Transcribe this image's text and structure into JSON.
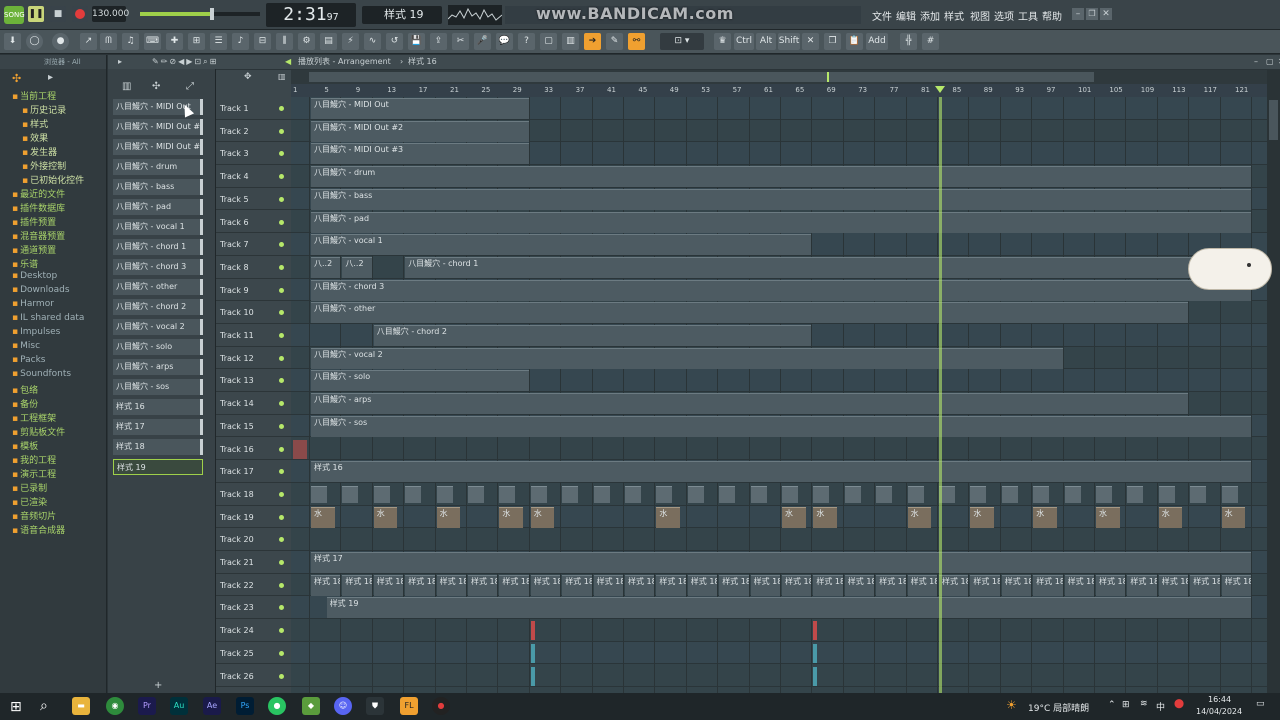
{
  "transport": {
    "tempo": "130.000",
    "time": "2:31",
    "time_frac": "97",
    "pattern": "样式 19"
  },
  "watermark": "www.BANDICAM.com",
  "menu": [
    "文件",
    "编辑",
    "添加",
    "样式",
    "视图",
    "选项",
    "工具",
    "帮助"
  ],
  "toolbar": {
    "ctrl": "Ctrl",
    "alt": "Alt",
    "shift": "Shift",
    "add": "Add"
  },
  "browser": {
    "title": "浏览器 - All",
    "items": [
      {
        "label": "当前工程",
        "kind": "root"
      },
      {
        "label": "历史记录",
        "kind": "sub"
      },
      {
        "label": "样式",
        "kind": "sub"
      },
      {
        "label": "效果",
        "kind": "sub"
      },
      {
        "label": "发生器",
        "kind": "sub"
      },
      {
        "label": "外接控制",
        "kind": "sub"
      },
      {
        "label": "已初始化控件",
        "kind": "sub"
      },
      {
        "label": "最近的文件",
        "kind": "root"
      },
      {
        "label": "插件数据库",
        "kind": "root"
      },
      {
        "label": "插件预置",
        "kind": "root"
      },
      {
        "label": "混音器预置",
        "kind": "root"
      },
      {
        "label": "通道预置",
        "kind": "root"
      },
      {
        "label": "乐谱",
        "kind": "root"
      },
      {
        "label": "Desktop",
        "kind": "folder"
      },
      {
        "label": "Downloads",
        "kind": "folder"
      },
      {
        "label": "Harmor",
        "kind": "folder"
      },
      {
        "label": "IL shared data",
        "kind": "folder"
      },
      {
        "label": "Impulses",
        "kind": "folder"
      },
      {
        "label": "Misc",
        "kind": "folder"
      },
      {
        "label": "Packs",
        "kind": "folder"
      },
      {
        "label": "Soundfonts",
        "kind": "folder"
      },
      {
        "label": "包络",
        "kind": "root"
      },
      {
        "label": "备份",
        "kind": "root"
      },
      {
        "label": "工程框架",
        "kind": "root"
      },
      {
        "label": "剪贴板文件",
        "kind": "root"
      },
      {
        "label": "模板",
        "kind": "root"
      },
      {
        "label": "我的工程",
        "kind": "root"
      },
      {
        "label": "演示工程",
        "kind": "root"
      },
      {
        "label": "已录制",
        "kind": "root"
      },
      {
        "label": "已渲染",
        "kind": "root"
      },
      {
        "label": "音频切片",
        "kind": "root"
      },
      {
        "label": "语音合成器",
        "kind": "root"
      }
    ]
  },
  "picker": [
    "八目鰻穴 - MIDI Out",
    "八目鰻穴 - MIDI Out #2",
    "八目鰻穴 - MIDI Out #3",
    "八目鰻穴 - drum",
    "八目鰻穴 - bass",
    "八目鰻穴 - pad",
    "八目鰻穴 - vocal 1",
    "八目鰻穴 - chord 1",
    "八目鰻穴 - chord 3",
    "八目鰻穴 - other",
    "八目鰻穴 - chord 2",
    "八目鰻穴 - vocal 2",
    "八目鰻穴 - solo",
    "八目鰻穴 - arps",
    "八目鰻穴 - sos",
    "样式 16",
    "样式 17",
    "样式 18",
    "样式 19"
  ],
  "playlist": {
    "title": "播放列表 - Arrangement",
    "pattern": "样式 16",
    "ruler": [
      "1",
      "5",
      "9",
      "13",
      "17",
      "21",
      "25",
      "29",
      "33",
      "37",
      "41",
      "45",
      "49",
      "53",
      "57",
      "61",
      "65",
      "69",
      "73",
      "77",
      "81",
      "85",
      "89",
      "93",
      "97",
      "101",
      "105",
      "109",
      "113",
      "117",
      "121"
    ]
  },
  "tracks": [
    "Track 1",
    "Track 2",
    "Track 3",
    "Track 4",
    "Track 5",
    "Track 6",
    "Track 7",
    "Track 8",
    "Track 9",
    "Track 10",
    "Track 11",
    "Track 12",
    "Track 13",
    "Track 14",
    "Track 15",
    "Track 16",
    "Track 17",
    "Track 18",
    "Track 19",
    "Track 20",
    "Track 21",
    "Track 22",
    "Track 23",
    "Track 24",
    "Track 25",
    "Track 26"
  ],
  "clips": [
    {
      "track": 0,
      "bar": 1,
      "len": 28,
      "label": "八目鰻穴 - MIDI Out"
    },
    {
      "track": 1,
      "bar": 1,
      "len": 28,
      "label": "八目鰻穴 - MIDI Out #2"
    },
    {
      "track": 2,
      "bar": 1,
      "len": 28,
      "label": "八目鰻穴 - MIDI Out #3"
    },
    {
      "track": 3,
      "bar": 1,
      "len": 120,
      "label": "八目鰻穴 - drum"
    },
    {
      "track": 4,
      "bar": 1,
      "len": 120,
      "label": "八目鰻穴 - bass"
    },
    {
      "track": 5,
      "bar": 1,
      "len": 120,
      "label": "八目鰻穴 - pad"
    },
    {
      "track": 6,
      "bar": 1,
      "len": 64,
      "label": "八目鰻穴 - vocal 1"
    },
    {
      "track": 7,
      "bar": 1,
      "len": 4,
      "label": "八..2"
    },
    {
      "track": 7,
      "bar": 5,
      "len": 4,
      "label": "八..2"
    },
    {
      "track": 7,
      "bar": 13,
      "len": 108,
      "label": "八目鰻穴 - chord 1"
    },
    {
      "track": 8,
      "bar": 1,
      "len": 120,
      "label": "八目鰻穴 - chord 3"
    },
    {
      "track": 9,
      "bar": 1,
      "len": 112,
      "label": "八目鰻穴 - other"
    },
    {
      "track": 10,
      "bar": 9,
      "len": 56,
      "label": "八目鰻穴 - chord 2"
    },
    {
      "track": 11,
      "bar": 1,
      "len": 96,
      "label": "八目鰻穴 - vocal 2"
    },
    {
      "track": 12,
      "bar": 1,
      "len": 28,
      "label": "八目鰻穴 - solo"
    },
    {
      "track": 13,
      "bar": 1,
      "len": 112,
      "label": "八目鰻穴 - arps"
    },
    {
      "track": 14,
      "bar": 1,
      "len": 120,
      "label": "八目鰻穴 - sos"
    },
    {
      "track": 16,
      "bar": 1,
      "len": 120,
      "label": "样式 16"
    },
    {
      "track": 20,
      "bar": 1,
      "len": 120,
      "label": "样式 17"
    },
    {
      "track": 22,
      "bar": 3,
      "len": 118,
      "label": "样式 19"
    }
  ],
  "pattern18_bars": [
    "1",
    "5",
    "9",
    "13",
    "17",
    "21",
    "25",
    "29",
    "33",
    "37",
    "41",
    "45",
    "49",
    "53",
    "57",
    "61",
    "65",
    "69",
    "73",
    "77",
    "81",
    "85",
    "89",
    "93",
    "97",
    "101",
    "105",
    "109",
    "113",
    "117"
  ],
  "pattern18_label": "样式 18",
  "pattern19_label": "水",
  "playhead_bar": 81,
  "taskbar": {
    "weather": "19°C 局部晴朗",
    "ime": "中",
    "time": "16:44",
    "date": "14/04/2024"
  },
  "colors": {
    "accent": "#f0a030",
    "playhead": "#b6e86a"
  }
}
